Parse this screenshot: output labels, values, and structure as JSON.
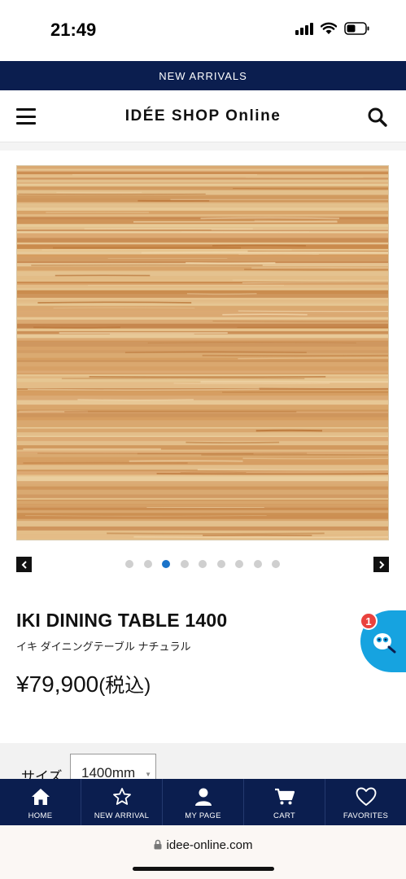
{
  "status_bar": {
    "time": "21:49"
  },
  "promo": {
    "text": "NEW ARRIVALS"
  },
  "header": {
    "logo": "IDÉE SHOP Online"
  },
  "carousel": {
    "total_slides": 9,
    "active_index": 2
  },
  "product": {
    "title": "IKI DINING TABLE 1400",
    "subtitle": "イキ ダイニングテーブル ナチュラル",
    "price": "¥79,900",
    "tax_note": "(税込)"
  },
  "chat": {
    "count": "1"
  },
  "options": {
    "size_label": "サイズ",
    "size_value": "1400mm"
  },
  "bottom_nav": {
    "home": "HOME",
    "new_arrival": "NEW ARRIVAL",
    "my_page": "MY PAGE",
    "cart": "CART",
    "favorites": "FAVORITES"
  },
  "browser": {
    "url": "idee-online.com"
  },
  "colors": {
    "navy": "#0b1e4f",
    "accent_blue": "#1a73c9",
    "chat_blue": "#16a3e0",
    "badge_red": "#e9423e"
  }
}
